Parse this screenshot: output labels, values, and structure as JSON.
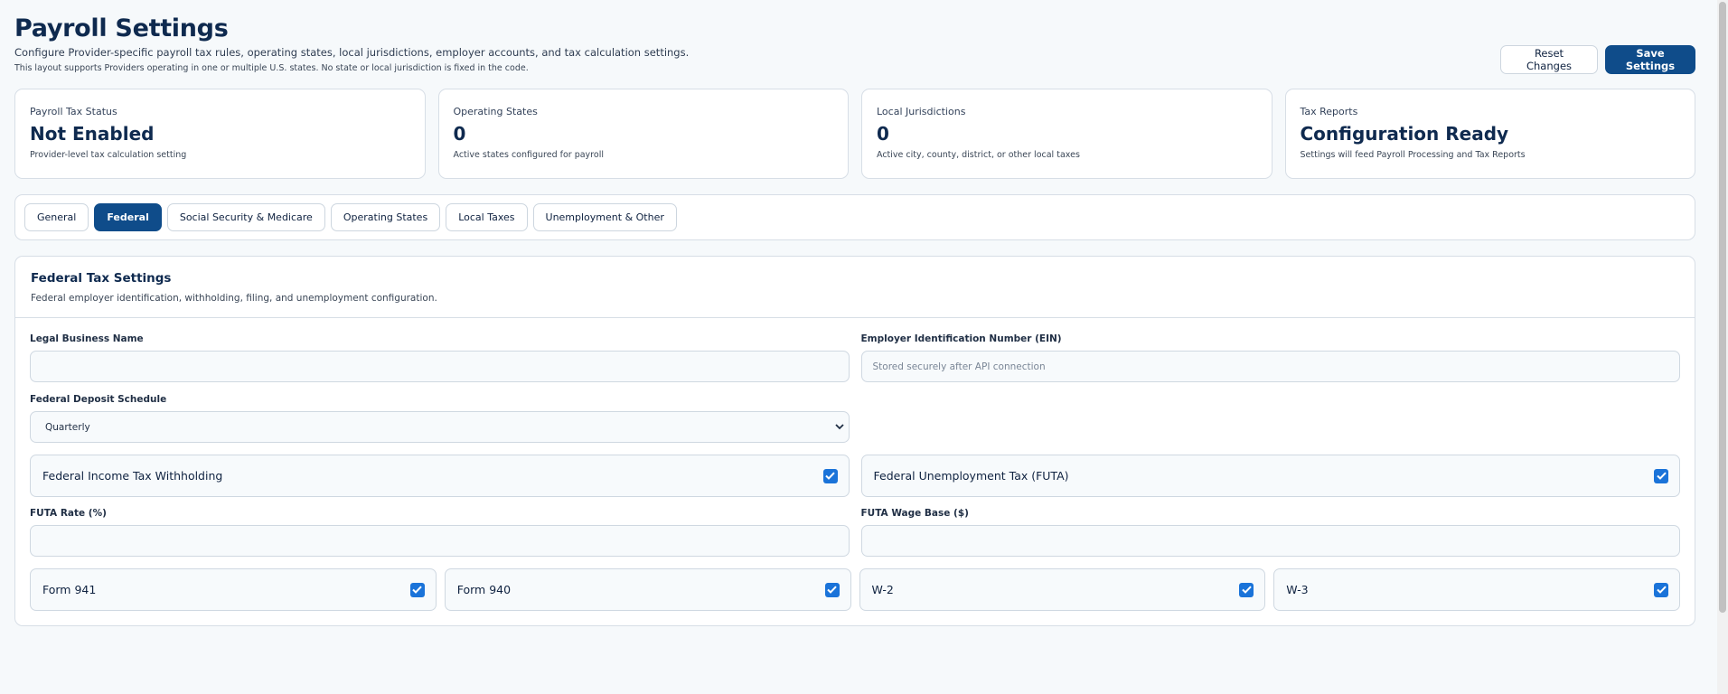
{
  "header": {
    "title": "Payroll Settings",
    "subtitle": "Configure Provider-specific payroll tax rules, operating states, local jurisdictions, employer accounts, and tax calculation settings.",
    "note": "This layout supports Providers operating in one or multiple U.S. states. No state or local jurisdiction is fixed in the code.",
    "reset_label": "Reset Changes",
    "save_label": "Save Settings"
  },
  "stats": [
    {
      "label": "Payroll Tax Status",
      "value": "Not Enabled",
      "desc": "Provider-level tax calculation setting"
    },
    {
      "label": "Operating States",
      "value": "0",
      "desc": "Active states configured for payroll"
    },
    {
      "label": "Local Jurisdictions",
      "value": "0",
      "desc": "Active city, county, district, or other local taxes"
    },
    {
      "label": "Tax Reports",
      "value": "Configuration Ready",
      "desc": "Settings will feed Payroll Processing and Tax Reports"
    }
  ],
  "tabs": [
    {
      "label": "General"
    },
    {
      "label": "Federal",
      "active": true
    },
    {
      "label": "Social Security & Medicare"
    },
    {
      "label": "Operating States"
    },
    {
      "label": "Local Taxes"
    },
    {
      "label": "Unemployment & Other"
    }
  ],
  "section": {
    "title": "Federal Tax Settings",
    "desc": "Federal employer identification, withholding, filing, and unemployment configuration.",
    "legal_name": {
      "label": "Legal Business Name",
      "value": "",
      "placeholder": ""
    },
    "ein": {
      "label": "Employer Identification Number (EIN)",
      "value": "",
      "placeholder": "Stored securely after API connection"
    },
    "deposit_schedule": {
      "label": "Federal Deposit Schedule",
      "selected": "Quarterly"
    },
    "income_tax": {
      "label": "Federal Income Tax Withholding",
      "checked": true
    },
    "futa": {
      "label": "Federal Unemployment Tax (FUTA)",
      "checked": true
    },
    "futa_rate": {
      "label": "FUTA Rate (%)",
      "value": ""
    },
    "futa_wage_base": {
      "label": "FUTA Wage Base ($)",
      "value": ""
    },
    "forms": [
      {
        "label": "Form 941",
        "checked": true
      },
      {
        "label": "Form 940",
        "checked": true
      },
      {
        "label": "W-2",
        "checked": true
      },
      {
        "label": "W-3",
        "checked": true
      }
    ]
  },
  "colors": {
    "primary": "#0f4c8a",
    "checkbox": "#1a73d9"
  }
}
